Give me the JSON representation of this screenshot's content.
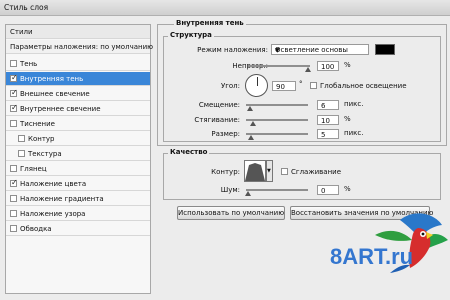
{
  "window": {
    "title": "Стиль слоя"
  },
  "left_panel": {
    "header": "Стили",
    "subheader": "Параметры наложения: по умолчанию",
    "items": [
      {
        "label": "Тень",
        "checked": false,
        "indent": 0,
        "selected": false
      },
      {
        "label": "Внутренняя тень",
        "checked": true,
        "indent": 0,
        "selected": true
      },
      {
        "label": "Внешнее свечение",
        "checked": true,
        "indent": 0,
        "selected": false
      },
      {
        "label": "Внутреннее свечение",
        "checked": true,
        "indent": 0,
        "selected": false
      },
      {
        "label": "Тиснение",
        "checked": false,
        "indent": 0,
        "selected": false
      },
      {
        "label": "Контур",
        "checked": false,
        "indent": 1,
        "selected": false
      },
      {
        "label": "Текстура",
        "checked": false,
        "indent": 1,
        "selected": false
      },
      {
        "label": "Глянец",
        "checked": false,
        "indent": 0,
        "selected": false
      },
      {
        "label": "Наложение цвета",
        "checked": true,
        "indent": 0,
        "selected": false
      },
      {
        "label": "Наложение градиента",
        "checked": false,
        "indent": 0,
        "selected": false
      },
      {
        "label": "Наложение узора",
        "checked": false,
        "indent": 0,
        "selected": false
      },
      {
        "label": "Обводка",
        "checked": false,
        "indent": 0,
        "selected": false
      }
    ]
  },
  "inner_shadow": {
    "title": "Внутренняя тень",
    "structure": {
      "title": "Структура",
      "blend_mode_label": "Режим наложения:",
      "blend_mode_value": "Осветление основы",
      "color": "#000000",
      "opacity_label": "Непрозр.:",
      "opacity_value": "100",
      "opacity_unit": "%",
      "opacity_level": 1.0,
      "angle_label": "Угол:",
      "angle_value": "90",
      "angle_unit": "°",
      "global_light_label": "Глобальное освещение",
      "global_light_checked": false,
      "distance_label": "Смещение:",
      "distance_value": "6",
      "distance_unit": "пикс.",
      "choke_label": "Стягивание:",
      "choke_value": "10",
      "choke_unit": "%",
      "size_label": "Размер:",
      "size_value": "5",
      "size_unit": "пикс."
    },
    "quality": {
      "title": "Качество",
      "contour_label": "Контур:",
      "antialias_label": "Сглаживание",
      "antialias_checked": false,
      "noise_label": "Шум:",
      "noise_value": "0",
      "noise_unit": "%"
    },
    "default_button": "Использовать по умолчанию",
    "reset_button": "Восстановить значения по умолчанию"
  },
  "watermark": {
    "text": "8ART.ru"
  }
}
